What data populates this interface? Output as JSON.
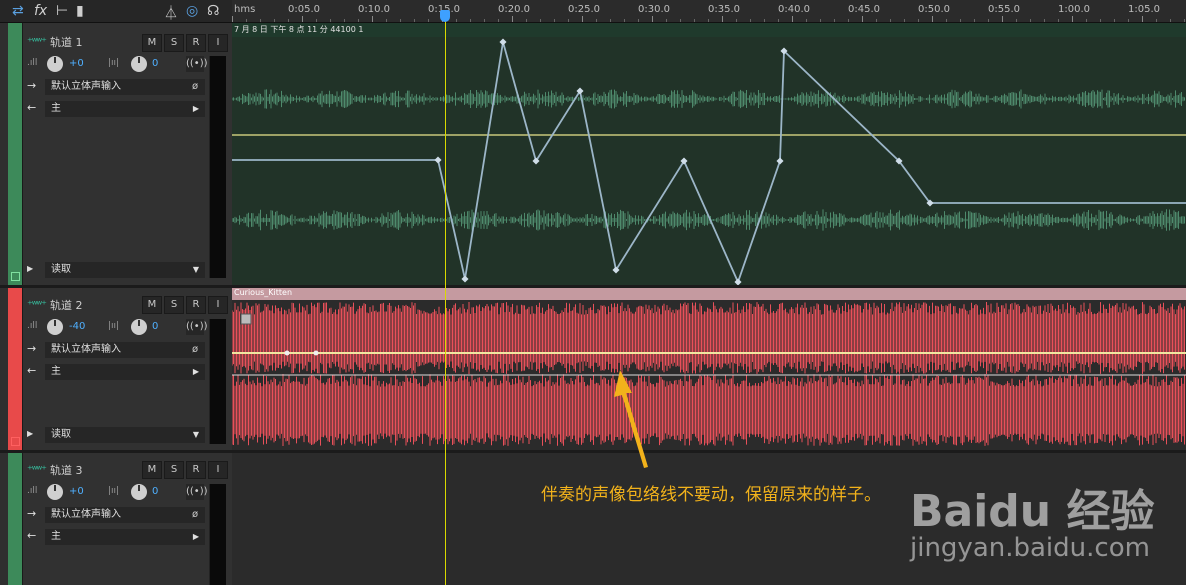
{
  "toolbar": {
    "icons": [
      "loop-icon",
      "fx-icon",
      "send-icon",
      "meter-icon",
      "metronome-icon",
      "monitor-icon",
      "headphone-icon"
    ],
    "fx_label": "fx"
  },
  "ruler": {
    "unit": "hms",
    "labels": [
      "0:05.0",
      "0:10.0",
      "0:15.0",
      "0:20.0",
      "0:25.0",
      "0:30.0",
      "0:35.0",
      "0:40.0",
      "0:45.0",
      "0:50.0",
      "0:55.0",
      "1:00.0",
      "1:05.0"
    ]
  },
  "tracks": [
    {
      "name": "轨道 1",
      "volume": "+0",
      "pan": "0",
      "input": "默认立体声输入",
      "output": "主",
      "automation": "读取",
      "color": "#3d8a5a"
    },
    {
      "name": "轨道 2",
      "volume": "-40",
      "pan": "0",
      "input": "默认立体声输入",
      "output": "主",
      "automation": "读取",
      "color": "#e84a4a"
    },
    {
      "name": "轨道 3",
      "volume": "+0",
      "pan": "0",
      "input": "默认立体声输入",
      "output": "主",
      "color": "#3d8a5a"
    }
  ],
  "buttons": {
    "mute": "M",
    "solo": "S",
    "record": "R",
    "input": "I"
  },
  "clips": {
    "clip1_label": "7 月 8 日 下午 8 点 11 分 44100 1",
    "clip2_label": "Curious_Kitten"
  },
  "annotation": "伴奏的声像包络线不要动，保留原来的样子。",
  "watermark": {
    "logo": "Baidu 经验",
    "url": "jingyan.baidu.com"
  },
  "colors": {
    "accent": "#3ea0ff",
    "playhead": "#d9d900",
    "annotation": "#f2b21b",
    "clip2_wave": "#e8505a"
  }
}
